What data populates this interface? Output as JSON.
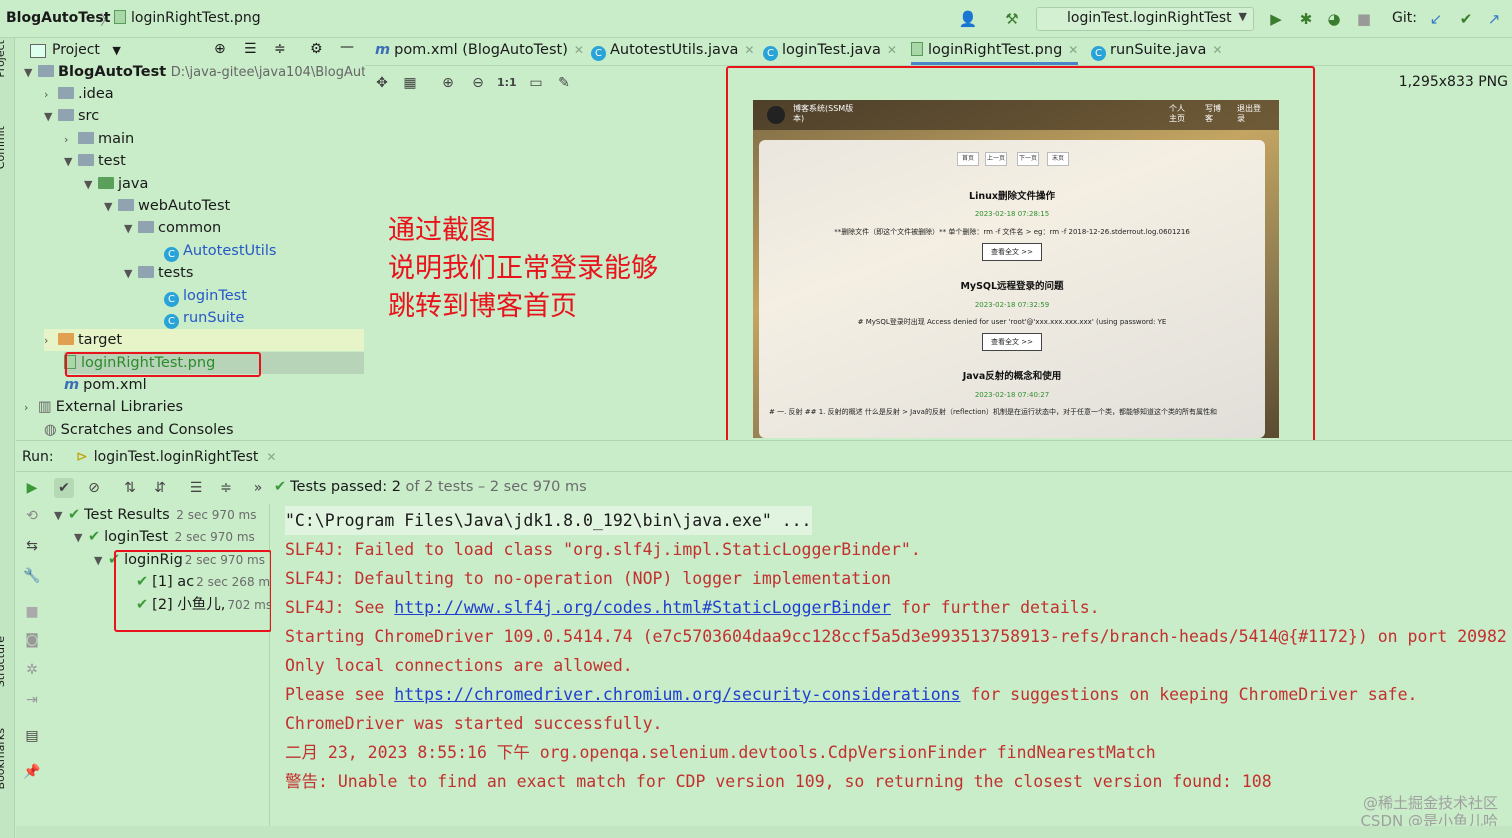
{
  "titlebar": {
    "project": "BlogAutoTest",
    "file": "loginRightTest.png",
    "run_config": "loginTest.loginRightTest",
    "git_label": "Git:"
  },
  "stripe": {
    "project": "Project",
    "commit": "Commit",
    "structure": "Structure",
    "bookmarks": "Bookmarks"
  },
  "project_panel": {
    "header": "Project",
    "rows": [
      {
        "label": "BlogAutoTest",
        "path": "D:\\java-gitee\\java104\\BlogAutc"
      },
      {
        "label": ".idea"
      },
      {
        "label": "src"
      },
      {
        "label": "main"
      },
      {
        "label": "test"
      },
      {
        "label": "java"
      },
      {
        "label": "webAutoTest"
      },
      {
        "label": "common"
      },
      {
        "label": "AutotestUtils"
      },
      {
        "label": "tests"
      },
      {
        "label": "loginTest"
      },
      {
        "label": "runSuite"
      },
      {
        "label": "target"
      },
      {
        "label": "loginRightTest.png"
      },
      {
        "label": "pom.xml"
      },
      {
        "label": "External Libraries"
      },
      {
        "label": "Scratches and Consoles"
      }
    ]
  },
  "tabs": [
    {
      "label": "pom.xml (BlogAutoTest)"
    },
    {
      "label": "AutotestUtils.java"
    },
    {
      "label": "loginTest.java"
    },
    {
      "label": "loginRightTest.png"
    },
    {
      "label": "runSuite.java"
    }
  ],
  "viewer": {
    "zoom_label": "1:1",
    "image_info": "1,295x833 PNG",
    "annotation": [
      "通过截图",
      "说明我们正常登录能够",
      "跳转到博客首页"
    ],
    "screenshot": {
      "site_title": "博客系统(SSM版本)",
      "nav": [
        "个人主页",
        "写博客",
        "退出登录"
      ],
      "pager": [
        "首页",
        "上一页",
        "下一页",
        "末页"
      ],
      "posts": [
        {
          "title": "Linux删除文件操作",
          "date": "2023-02-18 07:28:15",
          "body": "**删除文件（即这个文件被删除）** 单个删除：rm -f 文件名 > eg：rm -f 2018-12-26.stderrout.log.0601216",
          "button": "查看全文 >>"
        },
        {
          "title": "MySQL远程登录的问题",
          "date": "2023-02-18 07:32:59",
          "body": "# MySQL登录时出现 Access denied for user 'root'@'xxx.xxx.xxx.xxx' (using password: YE",
          "button": "查看全文 >>"
        },
        {
          "title": "Java反射的概念和使用",
          "date": "2023-02-18 07:40:27",
          "body": "# 一. 反射 ## 1. 反射的概述 什么是反射 > Java的反射（reflection）机制是在运行状态中，对于任意一个类，都能够知道这个类的所有属性和"
        }
      ]
    }
  },
  "run": {
    "label": "Run:",
    "tab": "loginTest.loginRightTest",
    "status": "Tests passed:",
    "passed": "2",
    "of_total": "of 2 tests – 2 sec 970 ms"
  },
  "results": [
    {
      "label": "Test Results",
      "dur": "2 sec 970 ms"
    },
    {
      "label": "loginTest",
      "dur": "2 sec 970 ms"
    },
    {
      "label": "loginRig",
      "dur": "2 sec 970 ms"
    },
    {
      "label": "[1] ac",
      "dur": "2 sec 268 ms"
    },
    {
      "label": "[2] 小鱼儿,",
      "dur": "702 ms"
    }
  ],
  "console": {
    "l0": "\"C:\\Program Files\\Java\\jdk1.8.0_192\\bin\\java.exe\" ...",
    "l1": "SLF4J: Failed to load class \"org.slf4j.impl.StaticLoggerBinder\".",
    "l2": "SLF4J: Defaulting to no-operation (NOP) logger implementation",
    "l3_pre": "SLF4J: See ",
    "l3_link": "http://www.slf4j.org/codes.html#StaticLoggerBinder",
    "l3_post": " for further details.",
    "l4": "Starting ChromeDriver 109.0.5414.74 (e7c5703604daa9cc128ccf5a5d3e993513758913-refs/branch-heads/5414@{#1172}) on port 20982",
    "l5": "Only local connections are allowed.",
    "l6_pre": "Please see ",
    "l6_link": "https://chromedriver.chromium.org/security-considerations",
    "l6_post": " for suggestions on keeping ChromeDriver safe.",
    "l7": "ChromeDriver was started successfully.",
    "l8": "二月 23, 2023 8:55:16 下午 org.openqa.selenium.devtools.CdpVersionFinder findNearestMatch",
    "l9": "警告: Unable to find an exact match for CDP version 109, so returning the closest version found: 108"
  },
  "watermark": [
    "@稀土掘金技术社区",
    "CSDN @是小鱼儿哈"
  ],
  "colors": {
    "background": "#c9ecc9",
    "accent_red": "#e8131b",
    "console_red": "#c2312f",
    "link_blue": "#1f3fcf"
  }
}
